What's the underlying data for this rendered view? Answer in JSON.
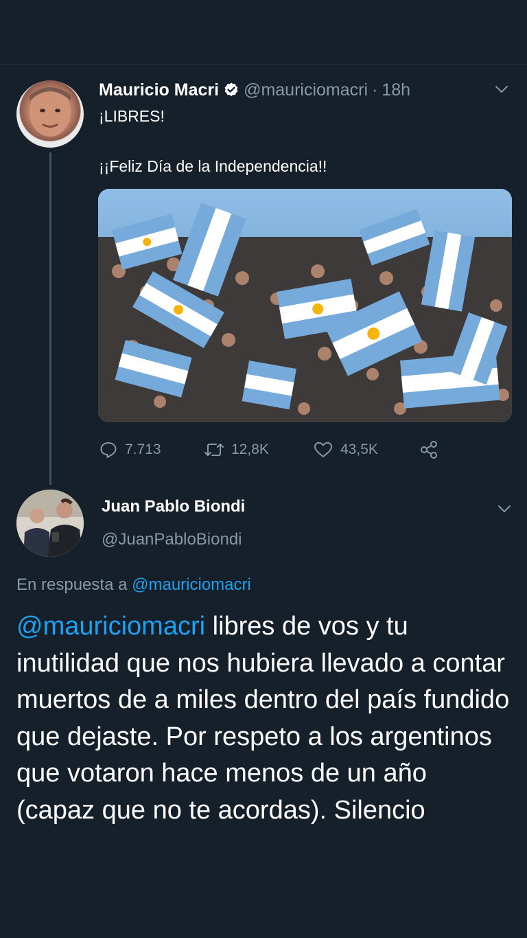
{
  "tweet": {
    "author_name": "Mauricio Macri",
    "author_handle": "@mauriciomacri",
    "separator": "·",
    "time": "18h",
    "verified_icon": "verified-badge-icon",
    "line1": "¡LIBRES!",
    "line2": "¡¡Feliz Día de la Independencia!!",
    "media_description_icon": "photo-crowd-flags",
    "stats": {
      "replies": "7.713",
      "retweets": "12,8K",
      "likes": "43,5K"
    }
  },
  "reply": {
    "author_name": "Juan Pablo Biondi",
    "author_handle": "@JuanPabloBiondi",
    "reply_prefix": "En respuesta a ",
    "reply_mention": "@mauriciomacri",
    "body_mention": "@mauriciomacri",
    "body_text": " libres de vos y tu inutilidad que nos hubiera llevado a contar muertos de a miles dentro del país fundido que dejaste. Por respeto a los argentinos que votaron hace menos de un año (capaz que no te acordas). Silencio"
  },
  "colors": {
    "background": "#15202b",
    "accent": "#1da1f2",
    "muted": "#8899a6"
  }
}
